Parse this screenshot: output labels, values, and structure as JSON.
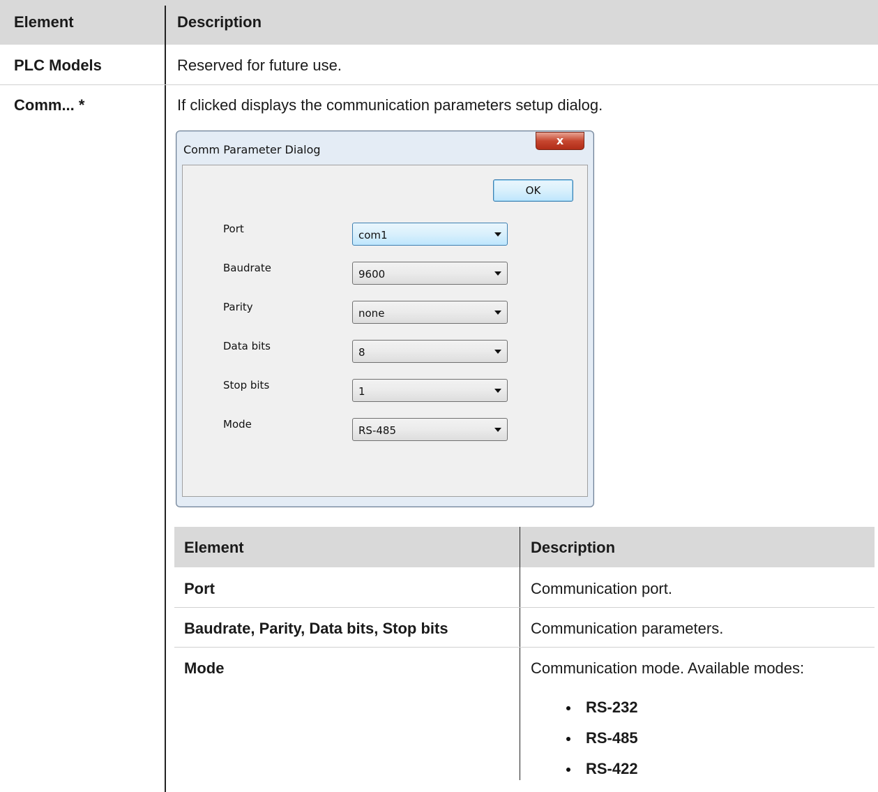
{
  "outer_table": {
    "headers": [
      "Element",
      "Description"
    ],
    "rows": [
      {
        "element": "PLC Models",
        "description": "Reserved for future use."
      },
      {
        "element": "Comm... *",
        "description": "If clicked displays the communication parameters setup dialog."
      }
    ]
  },
  "dialog": {
    "title": "Comm Parameter Dialog",
    "close_glyph": "x",
    "ok_label": "OK",
    "fields": [
      {
        "label": "Port",
        "value": "com1"
      },
      {
        "label": "Baudrate",
        "value": "9600"
      },
      {
        "label": "Parity",
        "value": "none"
      },
      {
        "label": "Data bits",
        "value": "8"
      },
      {
        "label": "Stop bits",
        "value": "1"
      },
      {
        "label": "Mode",
        "value": "RS-485"
      }
    ]
  },
  "inner_table": {
    "headers": [
      "Element",
      "Description"
    ],
    "rows": [
      {
        "element": "Port",
        "description": "Communication port."
      },
      {
        "element": "Baudrate, Parity, Data bits, Stop bits",
        "description": "Communication parameters."
      },
      {
        "element": "Mode",
        "description": "Communication mode. Available modes:"
      }
    ],
    "modes": [
      "RS-232",
      "RS-485",
      "RS-422"
    ]
  }
}
